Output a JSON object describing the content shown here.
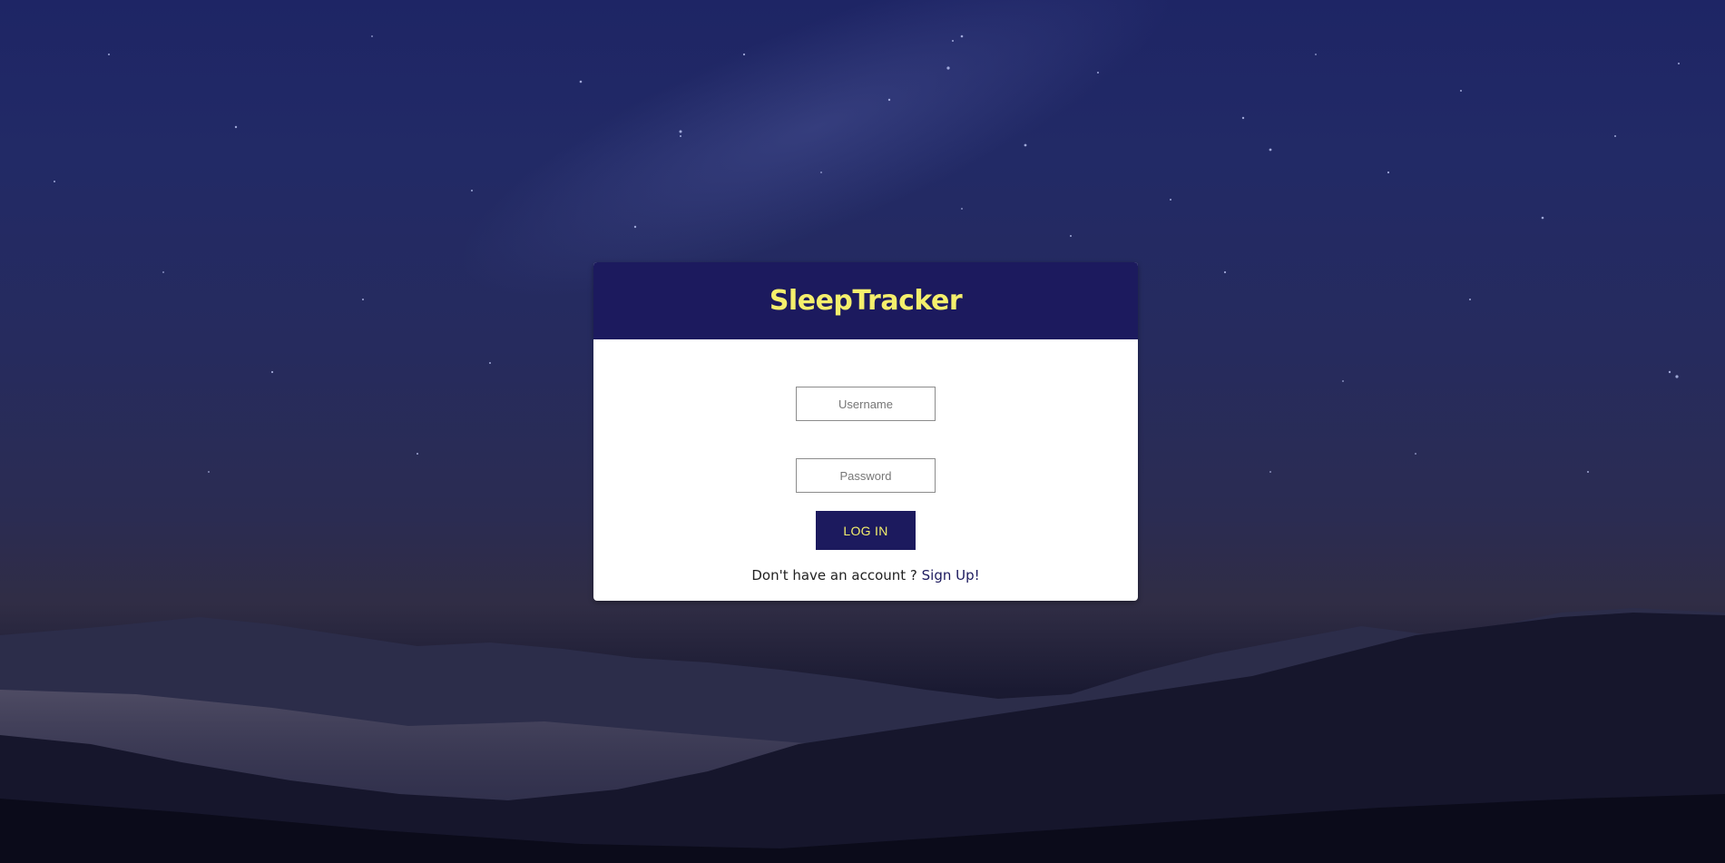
{
  "app": {
    "title": "SleepTracker"
  },
  "login_form": {
    "username_placeholder": "Username",
    "password_placeholder": "Password",
    "submit_label": "LOG IN"
  },
  "signup": {
    "prompt": "Don't have an account ? ",
    "link_label": "Sign Up!"
  },
  "colors": {
    "brand_navy": "#1c1a5e",
    "brand_yellow": "#f4ef6c",
    "card_background": "#ffffff"
  }
}
